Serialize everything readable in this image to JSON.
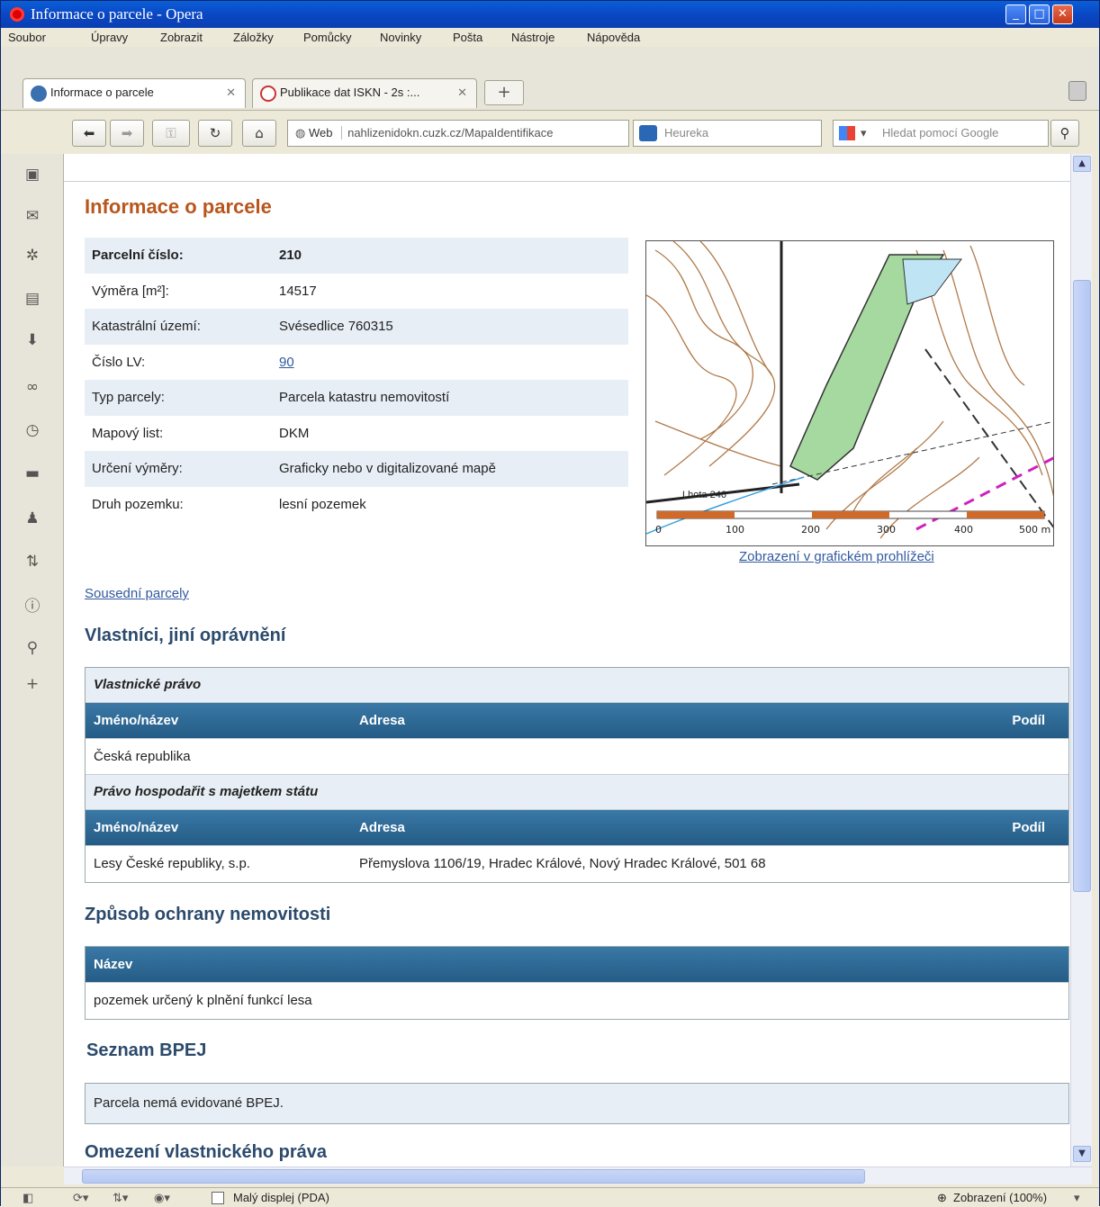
{
  "window": {
    "title": "Informace o parcele - Opera"
  },
  "menu": [
    "Soubor",
    "Úpravy",
    "Zobrazit",
    "Záložky",
    "Pomůcky",
    "Novinky",
    "Pošta",
    "Nástroje",
    "Nápověda"
  ],
  "tabs": [
    {
      "label": "Informace o parcele"
    },
    {
      "label": "Publikace dat ISKN - 2s :..."
    }
  ],
  "toolbar": {
    "web_label": "Web",
    "address": "nahlizenidokn.cuzk.cz/MapaIdentifikace",
    "address_domain": "cuzk.cz",
    "search1_placeholder": "Heureka",
    "search2_placeholder": "Hledat pomocí Google"
  },
  "page": {
    "title": "Informace o parcele",
    "info": [
      {
        "key": "Parcelní číslo:",
        "value": "210",
        "bold": true
      },
      {
        "key": "Výměra [m²]:",
        "value": "14517"
      },
      {
        "key": "Katastrální území:",
        "value": "Svésedlice 760315"
      },
      {
        "key": "Číslo LV:",
        "value": "90",
        "link": true
      },
      {
        "key": "Typ parcely:",
        "value": "Parcela katastru nemovitostí"
      },
      {
        "key": "Mapový list:",
        "value": "DKM"
      },
      {
        "key": "Určení výměry:",
        "value": "Graficky nebo v digitalizované mapě"
      },
      {
        "key": "Druh pozemku:",
        "value": "lesní pozemek"
      }
    ],
    "map_link": "Zobrazení v grafickém prohlížeči",
    "map_scale": [
      "0",
      "100",
      "200",
      "300",
      "400",
      "500 m"
    ],
    "map_label": "Lhota 246",
    "neighbors_link": "Sousední parcely",
    "owners": {
      "heading": "Vlastníci, jiní oprávnění",
      "sections": [
        {
          "title": "Vlastnické právo",
          "cols": [
            "Jméno/název",
            "Adresa",
            "Podíl"
          ],
          "rows": [
            [
              "Česká republika",
              "",
              ""
            ]
          ]
        },
        {
          "title": "Právo hospodařit s majetkem státu",
          "cols": [
            "Jméno/název",
            "Adresa",
            "Podíl"
          ],
          "rows": [
            [
              "Lesy České republiky, s.p.",
              "Přemyslova 1106/19, Hradec Králové, Nový Hradec Králové, 501 68",
              ""
            ]
          ]
        }
      ]
    },
    "protection": {
      "heading": "Způsob ochrany nemovitosti",
      "col": "Název",
      "value": "pozemek určený k plnění funkcí lesa"
    },
    "bpej": {
      "heading": "Seznam BPEJ",
      "value": "Parcela nemá evidované BPEJ."
    },
    "restrictions": {
      "heading": "Omezení vlastnického práva"
    }
  },
  "status": {
    "small_display": "Malý displej (PDA)",
    "zoom": "Zobrazení (100%)"
  }
}
